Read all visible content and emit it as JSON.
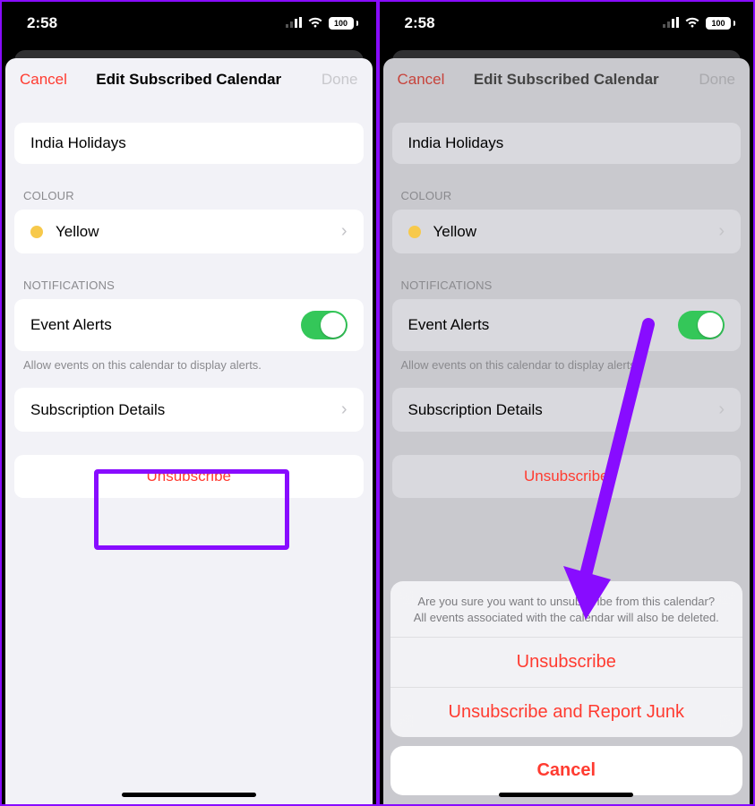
{
  "status": {
    "time": "2:58",
    "battery": "100"
  },
  "nav": {
    "cancel": "Cancel",
    "title": "Edit Subscribed Calendar",
    "done": "Done"
  },
  "calendar": {
    "name": "India Holidays"
  },
  "colour": {
    "header": "COLOUR",
    "name": "Yellow"
  },
  "notifications": {
    "header": "NOTIFICATIONS",
    "eventAlerts": "Event Alerts",
    "helper": "Allow events on this calendar to display alerts."
  },
  "subscriptionDetails": "Subscription Details",
  "unsubscribe": "Unsubscribe",
  "actionSheet": {
    "message": "Are you sure you want to unsubscribe from this calendar? All events associated with the calendar will also be deleted.",
    "unsubscribe": "Unsubscribe",
    "reportJunk": "Unsubscribe and Report Junk",
    "cancel": "Cancel"
  }
}
